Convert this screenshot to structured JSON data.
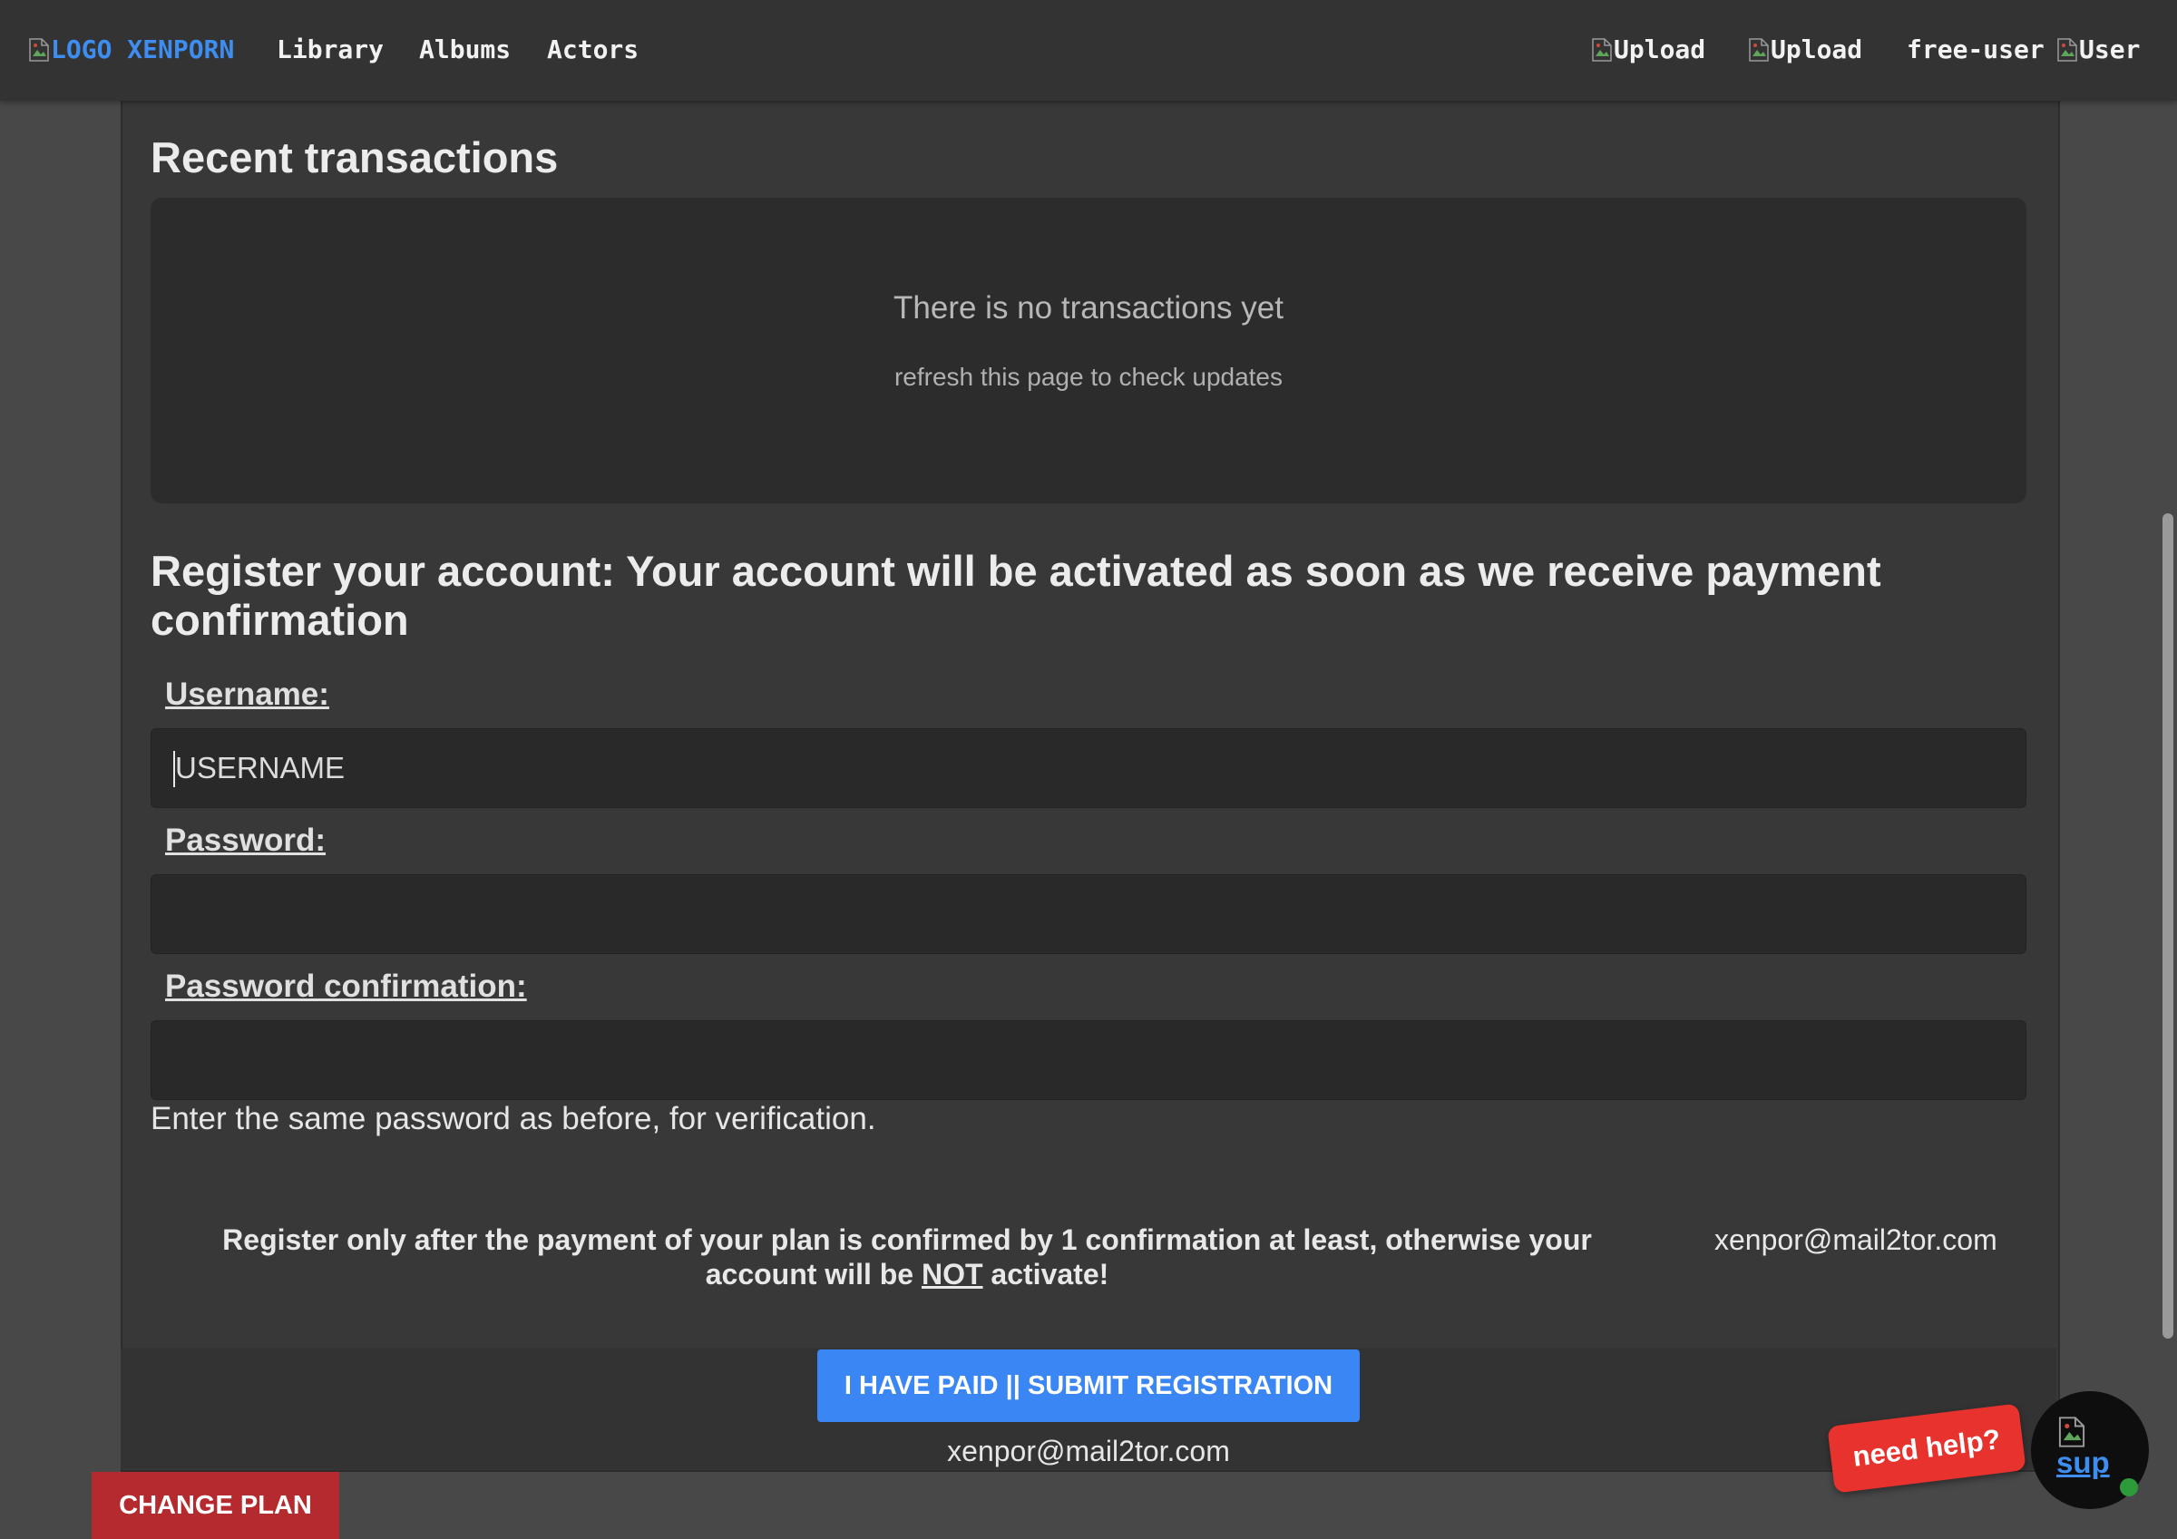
{
  "nav": {
    "logo_alt": "LOGO",
    "brand": "XENPORN",
    "links": [
      "Library",
      "Albums",
      "Actors"
    ],
    "upload_1": "Upload",
    "upload_2": "Upload",
    "username": "free-user",
    "user_img_alt": "User",
    "accent_color": "#3d8ef0"
  },
  "transactions": {
    "title": "Recent transactions",
    "empty_message": "There is no transactions yet",
    "refresh_hint": "refresh this page to check updates"
  },
  "register": {
    "title": "Register your account: Your account will be activated as soon as we receive payment confirmation",
    "username_label": "Username:",
    "username_placeholder": "USERNAME",
    "password_label": "Password:",
    "password_confirm_label": "Password confirmation:",
    "help_text": "Enter the same password as before, for verification.",
    "notice_before": "Register only after the payment of your plan is confirmed by 1 confirmation at least, otherwise your account will be ",
    "notice_emphasis": "NOT",
    "notice_after": " activate!",
    "notice_email": "xenpor@mail2tor.com",
    "submit_label": "I HAVE PAID || SUBMIT REGISTRATION",
    "footer_email": "xenpor@mail2tor.com",
    "submit_color": "#3a86f5"
  },
  "change_plan_label": "CHANGE PLAN",
  "change_plan_color": "#b52a2e",
  "support": {
    "need_help_label": "need help?",
    "link_text": "sup",
    "badge_color": "#e8322e",
    "online_color": "#2e9b3a"
  }
}
